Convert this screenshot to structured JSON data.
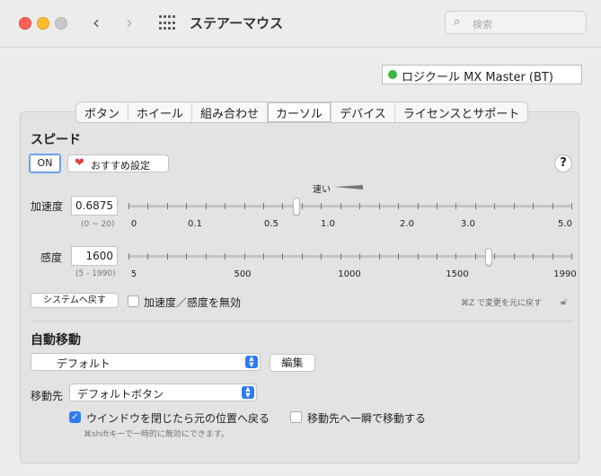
{
  "window": {
    "title": "ステアーマウス"
  },
  "search": {
    "placeholder": "検索",
    "icon": "search-icon"
  },
  "device": {
    "name": "ロジクール MX Master (BT)",
    "status_color": "#38b640"
  },
  "tabs": [
    {
      "label": "ボタン",
      "active": false
    },
    {
      "label": "ホイール",
      "active": false
    },
    {
      "label": "組み合わせ",
      "active": false
    },
    {
      "label": "カーソル",
      "active": true
    },
    {
      "label": "デバイス",
      "active": false
    },
    {
      "label": "ライセンスとサポート",
      "active": false
    }
  ],
  "speed": {
    "heading": "スピード",
    "on_label": "ON",
    "recommended_label": "おすすめ設定",
    "help_label": "?",
    "acceleration": {
      "label": "加速度",
      "value": "0.6875",
      "range": "(0 ~ 20)",
      "fast_label": "速い",
      "tick_labels": [
        "0",
        "0.1",
        "0.5",
        "1.0",
        "2.0",
        "3.0",
        "5.0"
      ],
      "knob_fraction": 0.38
    },
    "sensitivity": {
      "label": "感度",
      "value": "1600",
      "range": "(5 - 1990)",
      "tick_labels": [
        "5",
        "500",
        "1000",
        "1500",
        "1990"
      ],
      "knob_fraction": 0.814
    },
    "system_button": "システムへ戻す",
    "disable_label": "加速度／感度を無効",
    "disable_checked": false,
    "undo_hint": "⌘Z で変更を元に戻す"
  },
  "auto_move": {
    "heading": "自動移動",
    "preset": "デフォルト",
    "edit_label": "編集",
    "dest_label": "移動先",
    "dest_value": "デフォルトボタン",
    "return_label": "ウインドウを閉じたら元の位置へ戻る",
    "return_checked": true,
    "instant_label": "移動先へ一瞬で移動する",
    "instant_checked": false,
    "note": "⌘shiftキーで一時的に無効にできます。"
  },
  "colors": {
    "accent": "#2d7cf6",
    "close": "#fe5f57",
    "minimize": "#febc2e"
  }
}
